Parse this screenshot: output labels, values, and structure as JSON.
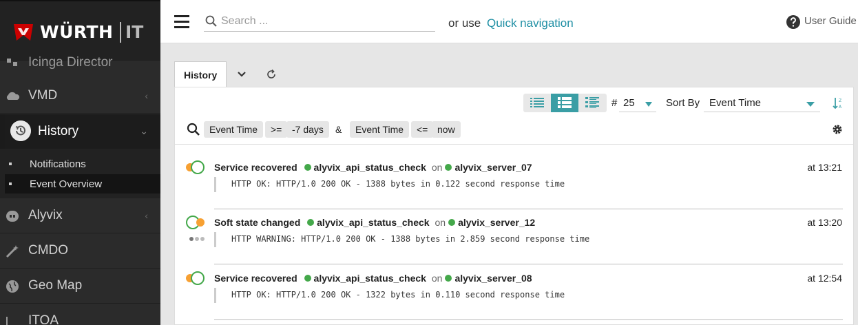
{
  "brand": {
    "name": "WÜRTH",
    "suffix": "IT",
    "color": "#cc0000"
  },
  "sidebar": {
    "items": [
      {
        "label": "Icinga Director",
        "icon": "director-icon"
      },
      {
        "label": "VMD",
        "icon": "cloud-icon"
      },
      {
        "label": "Alyvix",
        "icon": "robot-icon"
      },
      {
        "label": "CMDO",
        "icon": "wand-icon"
      },
      {
        "label": "Geo Map",
        "icon": "globe-icon"
      },
      {
        "label": "ITOA",
        "icon": "chart-icon"
      }
    ],
    "active": {
      "label": "History",
      "icon": "history-icon",
      "children": [
        {
          "label": "Notifications"
        },
        {
          "label": "Event Overview"
        }
      ]
    }
  },
  "header": {
    "search_placeholder": "Search ...",
    "or_use": "or use",
    "quick_navigation": "Quick navigation",
    "user_guide": "User Guide"
  },
  "tabs": {
    "active": "History"
  },
  "controls": {
    "limit_hash": "#",
    "limit_value": "25",
    "sort_label": "Sort By",
    "sort_value": "Event Time",
    "accent": "#3a9ea5"
  },
  "filter": {
    "left": {
      "column": "Event Time",
      "op": ">=",
      "value": "-7 days"
    },
    "joiner": "&",
    "right": {
      "column": "Event Time",
      "op": "<=",
      "value": "now"
    }
  },
  "events": [
    {
      "title": "Service recovered",
      "service": "alyvix_api_status_check",
      "on": "on",
      "host": "alyvix_server_07",
      "time": "at 13:21",
      "output": "HTTP OK: HTTP/1.0 200 OK - 1388 bytes in 0.122 second response time",
      "state": "recovered"
    },
    {
      "title": "Soft state changed",
      "service": "alyvix_api_status_check",
      "on": "on",
      "host": "alyvix_server_12",
      "time": "at 13:20",
      "output": "HTTP WARNING: HTTP/1.0 200 OK - 1388 bytes in 2.859 second response time",
      "state": "warning-soft"
    },
    {
      "title": "Service recovered",
      "service": "alyvix_api_status_check",
      "on": "on",
      "host": "alyvix_server_08",
      "time": "at 12:54",
      "output": "HTTP OK: HTTP/1.0 200 OK - 1322 bytes in 0.110 second response time",
      "state": "recovered"
    }
  ],
  "colors": {
    "ok": "#44a84a",
    "warning": "#f7a032"
  }
}
